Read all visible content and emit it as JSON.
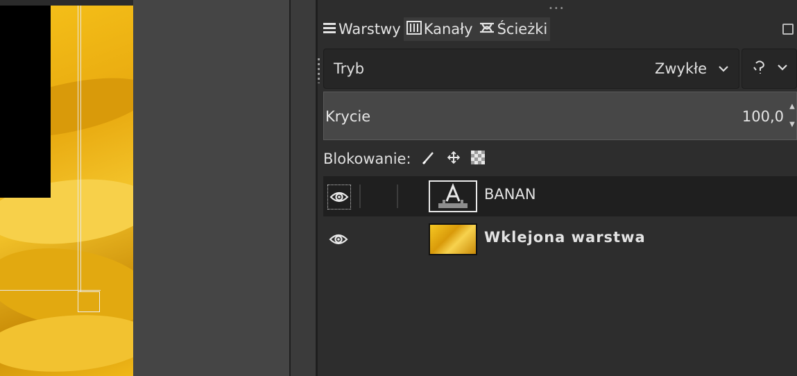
{
  "dock": {
    "tabs": [
      {
        "label": "Warstwy",
        "icon": "layers-icon"
      },
      {
        "label": "Kanały",
        "icon": "channels-icon"
      },
      {
        "label": "Ścieżki",
        "icon": "paths-icon"
      }
    ],
    "mode": {
      "label": "Tryb",
      "value": "Zwykłe"
    },
    "opacity": {
      "label": "Krycie",
      "value": "100,0"
    },
    "lock": {
      "label": "Blokowanie:",
      "icons": [
        "lock-pixels-icon",
        "lock-position-icon",
        "lock-alpha-icon"
      ]
    },
    "layers": [
      {
        "name": "BANAN",
        "type": "text",
        "visible": true,
        "selected": true
      },
      {
        "name": "Wklejona warstwa",
        "type": "image",
        "visible": true,
        "selected": false
      }
    ]
  },
  "colors": {
    "panel_bg": "#2d2d2d",
    "selected_row": "#1f1f1f",
    "opacity_field": "#474747",
    "canvas_accent": "#f6c21a"
  }
}
